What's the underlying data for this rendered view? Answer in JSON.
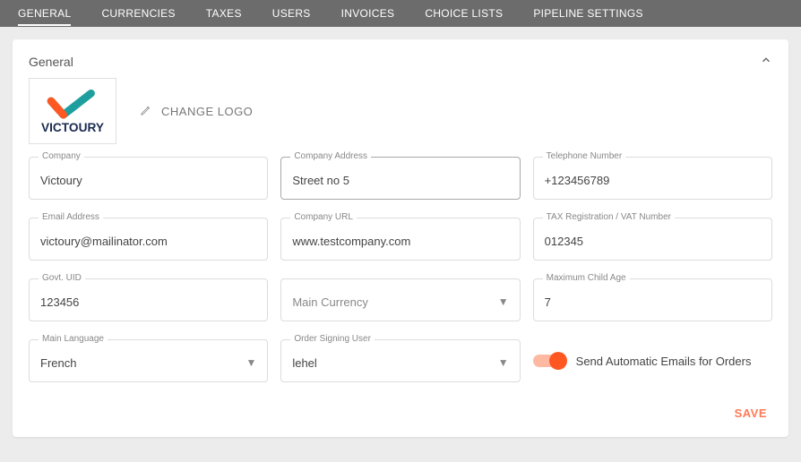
{
  "nav": {
    "items": [
      "GENERAL",
      "CURRENCIES",
      "TAXES",
      "USERS",
      "INVOICES",
      "CHOICE LISTS",
      "PIPELINE SETTINGS"
    ],
    "active": 0
  },
  "card": {
    "title": "General"
  },
  "logo": {
    "brand": "VICTOURY",
    "change_label": "CHANGE LOGO"
  },
  "fields": {
    "company": {
      "label": "Company",
      "value": "Victoury"
    },
    "address": {
      "label": "Company Address",
      "value": "Street no 5"
    },
    "phone": {
      "label": "Telephone Number",
      "value": "+123456789"
    },
    "email": {
      "label": "Email Address",
      "value": "victoury@mailinator.com"
    },
    "url": {
      "label": "Company URL",
      "value": "www.testcompany.com"
    },
    "vat": {
      "label": "TAX Registration / VAT Number",
      "value": "012345"
    },
    "govt": {
      "label": "Govt. UID",
      "value": "123456"
    },
    "currency": {
      "label": "",
      "placeholder": "Main Currency",
      "value": ""
    },
    "childage": {
      "label": "Maximum Child Age",
      "value": "7"
    },
    "language": {
      "label": "Main Language",
      "value": "French"
    },
    "signer": {
      "label": "Order Signing User",
      "value": "lehel"
    }
  },
  "toggle": {
    "label": "Send Automatic Emails for Orders",
    "on": true
  },
  "actions": {
    "save": "SAVE"
  }
}
